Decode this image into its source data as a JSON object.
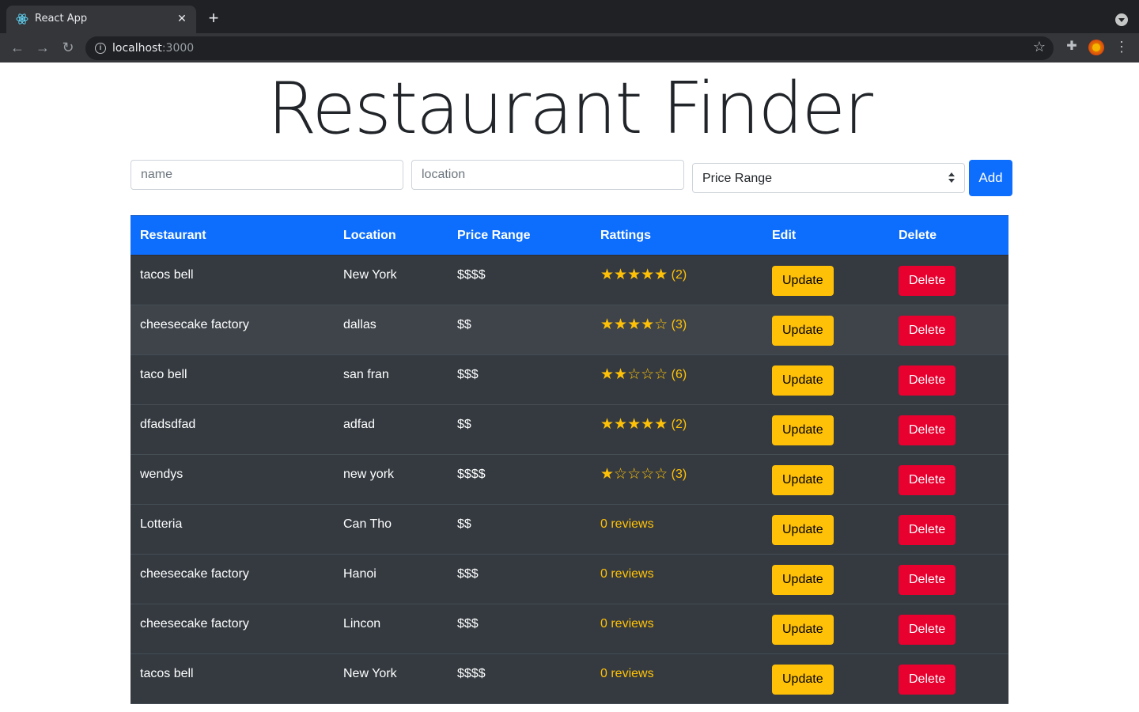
{
  "browser": {
    "tab_title": "React App",
    "url_host": "localhost",
    "url_port": ":3000"
  },
  "page": {
    "title": "Restaurant Finder"
  },
  "form": {
    "name_placeholder": "name",
    "location_placeholder": "location",
    "price_range_selected": "Price Range",
    "add_label": "Add"
  },
  "table": {
    "headers": [
      "Restaurant",
      "Location",
      "Price Range",
      "Rattings",
      "Edit",
      "Delete"
    ],
    "update_label": "Update",
    "delete_label": "Delete",
    "rows": [
      {
        "name": "tacos bell",
        "location": "New York",
        "price": "$$$$",
        "stars": "★★★★★",
        "count": "(2)",
        "reviews": ""
      },
      {
        "name": "cheesecake factory",
        "location": "dallas",
        "price": "$$",
        "stars": "★★★★☆",
        "count": "(3)",
        "reviews": ""
      },
      {
        "name": "taco bell",
        "location": "san fran",
        "price": "$$$",
        "stars": "★★☆☆☆",
        "count": "(6)",
        "reviews": ""
      },
      {
        "name": "dfadsdfad",
        "location": "adfad",
        "price": "$$",
        "stars": "★★★★★",
        "count": "(2)",
        "reviews": ""
      },
      {
        "name": "wendys",
        "location": "new york",
        "price": "$$$$",
        "stars": "★☆☆☆☆",
        "count": "(3)",
        "reviews": ""
      },
      {
        "name": "Lotteria",
        "location": "Can Tho",
        "price": "$$",
        "stars": "",
        "count": "",
        "reviews": "0 reviews"
      },
      {
        "name": "cheesecake factory",
        "location": "Hanoi",
        "price": "$$$",
        "stars": "",
        "count": "",
        "reviews": "0 reviews"
      },
      {
        "name": "cheesecake factory",
        "location": "Lincon",
        "price": "$$$",
        "stars": "",
        "count": "",
        "reviews": "0 reviews"
      },
      {
        "name": "tacos bell",
        "location": "New York",
        "price": "$$$$",
        "stars": "",
        "count": "",
        "reviews": "0 reviews"
      }
    ]
  },
  "colors": {
    "primary": "#0d6efd",
    "warning": "#ffc107",
    "danger": "#e8002f",
    "table_dark": "#343a40"
  },
  "icons": {
    "favicon": "react-icon",
    "back": "arrow-left-icon",
    "forward": "arrow-right-icon",
    "reload": "reload-icon",
    "site_info": "info-icon",
    "bookmark": "star-icon",
    "extensions": "puzzle-icon",
    "menu": "kebab-menu-icon"
  }
}
